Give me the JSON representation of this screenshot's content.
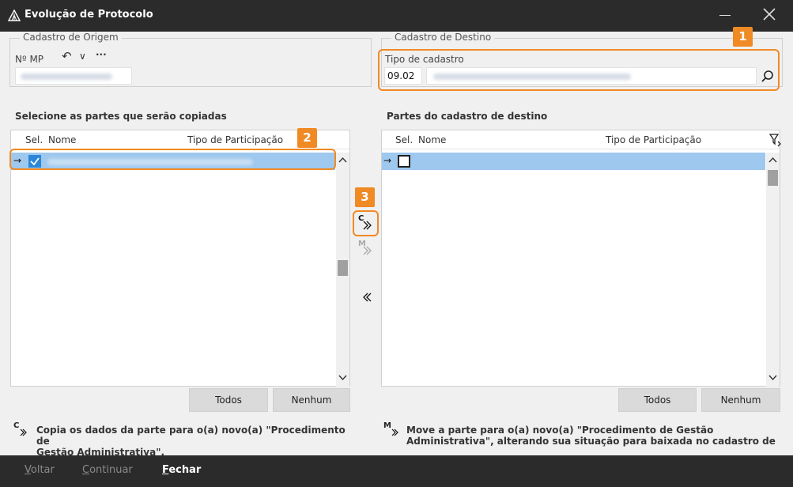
{
  "window": {
    "title": "Evolução de  Protocolo"
  },
  "origem": {
    "legend": "Cadastro de Origem",
    "mp_label": "Nº MP",
    "undo_glyph": "↶",
    "dropdown_glyph": "∨",
    "more_glyph": "···"
  },
  "destino": {
    "legend": "Cadastro de Destino",
    "tipo_label": "Tipo de cadastro",
    "tipo_code": "09.02"
  },
  "badges": {
    "b1": "1",
    "b2": "2",
    "b3": "3"
  },
  "left_panel": {
    "title": "Selecione as partes que serão copiadas",
    "col_sel": "Sel.",
    "col_nome": "Nome",
    "col_tipo": "Tipo de Participação",
    "todos": "Todos",
    "nenhum": "Nenhum"
  },
  "right_panel": {
    "title": "Partes do cadastro de destino",
    "col_sel": "Sel.",
    "col_nome": "Nome",
    "col_tipo": "Tipo de Participação",
    "todos": "Todos",
    "nenhum": "Nenhum"
  },
  "middle": {
    "copy_letter": "C",
    "move_letter": "M"
  },
  "notes": {
    "copy_letter": "C",
    "copy_line1": "Copia os dados da parte para o(a) novo(a) \"Procedimento de",
    "copy_line2": "Gestão Administrativa\".",
    "move_letter": "M",
    "move_line1": "Move a parte para o(a) novo(a) \"Procedimento de Gestão",
    "move_line2": "Administrativa\", alterando sua situação para baixada no cadastro de"
  },
  "footer": {
    "voltar_first": "V",
    "voltar_rest": "oltar",
    "continuar_first": "C",
    "continuar_rest": "ontinuar",
    "fechar_first": "F",
    "fechar_rest": "echar"
  },
  "colors": {
    "accent": "#f08a24",
    "selection": "#9ec8ee",
    "checkbox": "#2c86d9",
    "chrome": "#2b2b2b"
  }
}
